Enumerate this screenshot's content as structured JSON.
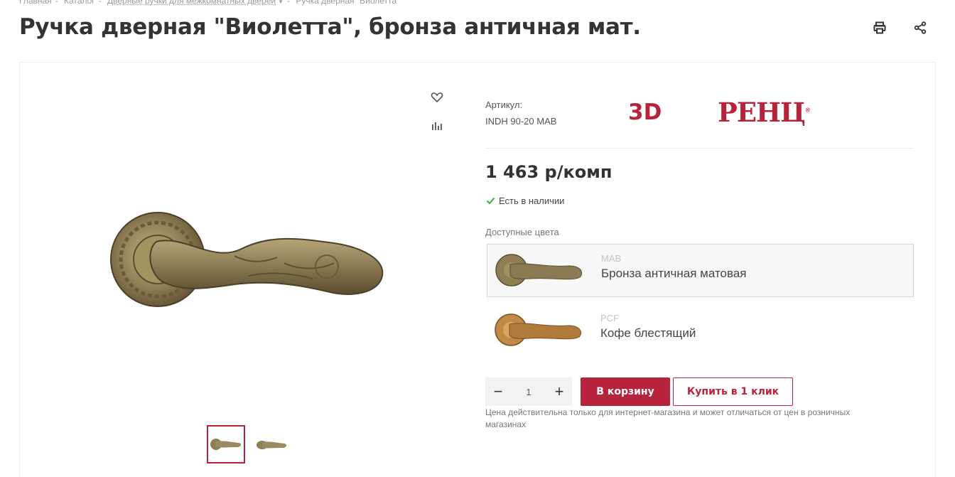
{
  "breadcrumb": {
    "home": "Главная",
    "catalog": "Каталог",
    "category": "Дверные ручки для межкомнатных дверей",
    "current": "Ручка дверная \"Виолетта\""
  },
  "product": {
    "title": "Ручка дверная \"Виолетта\", бронза античная мат.",
    "article_label": "Артикул:",
    "article_value": "INDH 90-20 MAB",
    "price": "1 463 р/комп",
    "stock": "Есть в наличии"
  },
  "brands": {
    "badge_3d": "3D",
    "brand": "РЕНЦ",
    "reg_mark": "®"
  },
  "colors": {
    "label": "Доступные цвета",
    "options": [
      {
        "code": "MAB",
        "name": "Бронза античная матовая",
        "selected": true
      },
      {
        "code": "PCF",
        "name": "Кофе блестящий",
        "selected": false
      }
    ]
  },
  "cart": {
    "minus": "−",
    "quantity": "1",
    "plus": "+",
    "add_to_cart": "В корзину",
    "buy_one_click": "Купить в 1 клик",
    "note": "Цена действительна только для интернет-магазина и может отличаться от цен в розничных магазинах"
  },
  "icons": {
    "print": "print-icon",
    "share": "share-icon",
    "favorite": "heart-icon",
    "compare": "compare-icon",
    "check": "check-icon"
  },
  "colors_theme": {
    "accent": "#b8233c",
    "bronze": "#8a7a55",
    "coffee": "#b07a3a",
    "stock_check": "#3aa935"
  }
}
